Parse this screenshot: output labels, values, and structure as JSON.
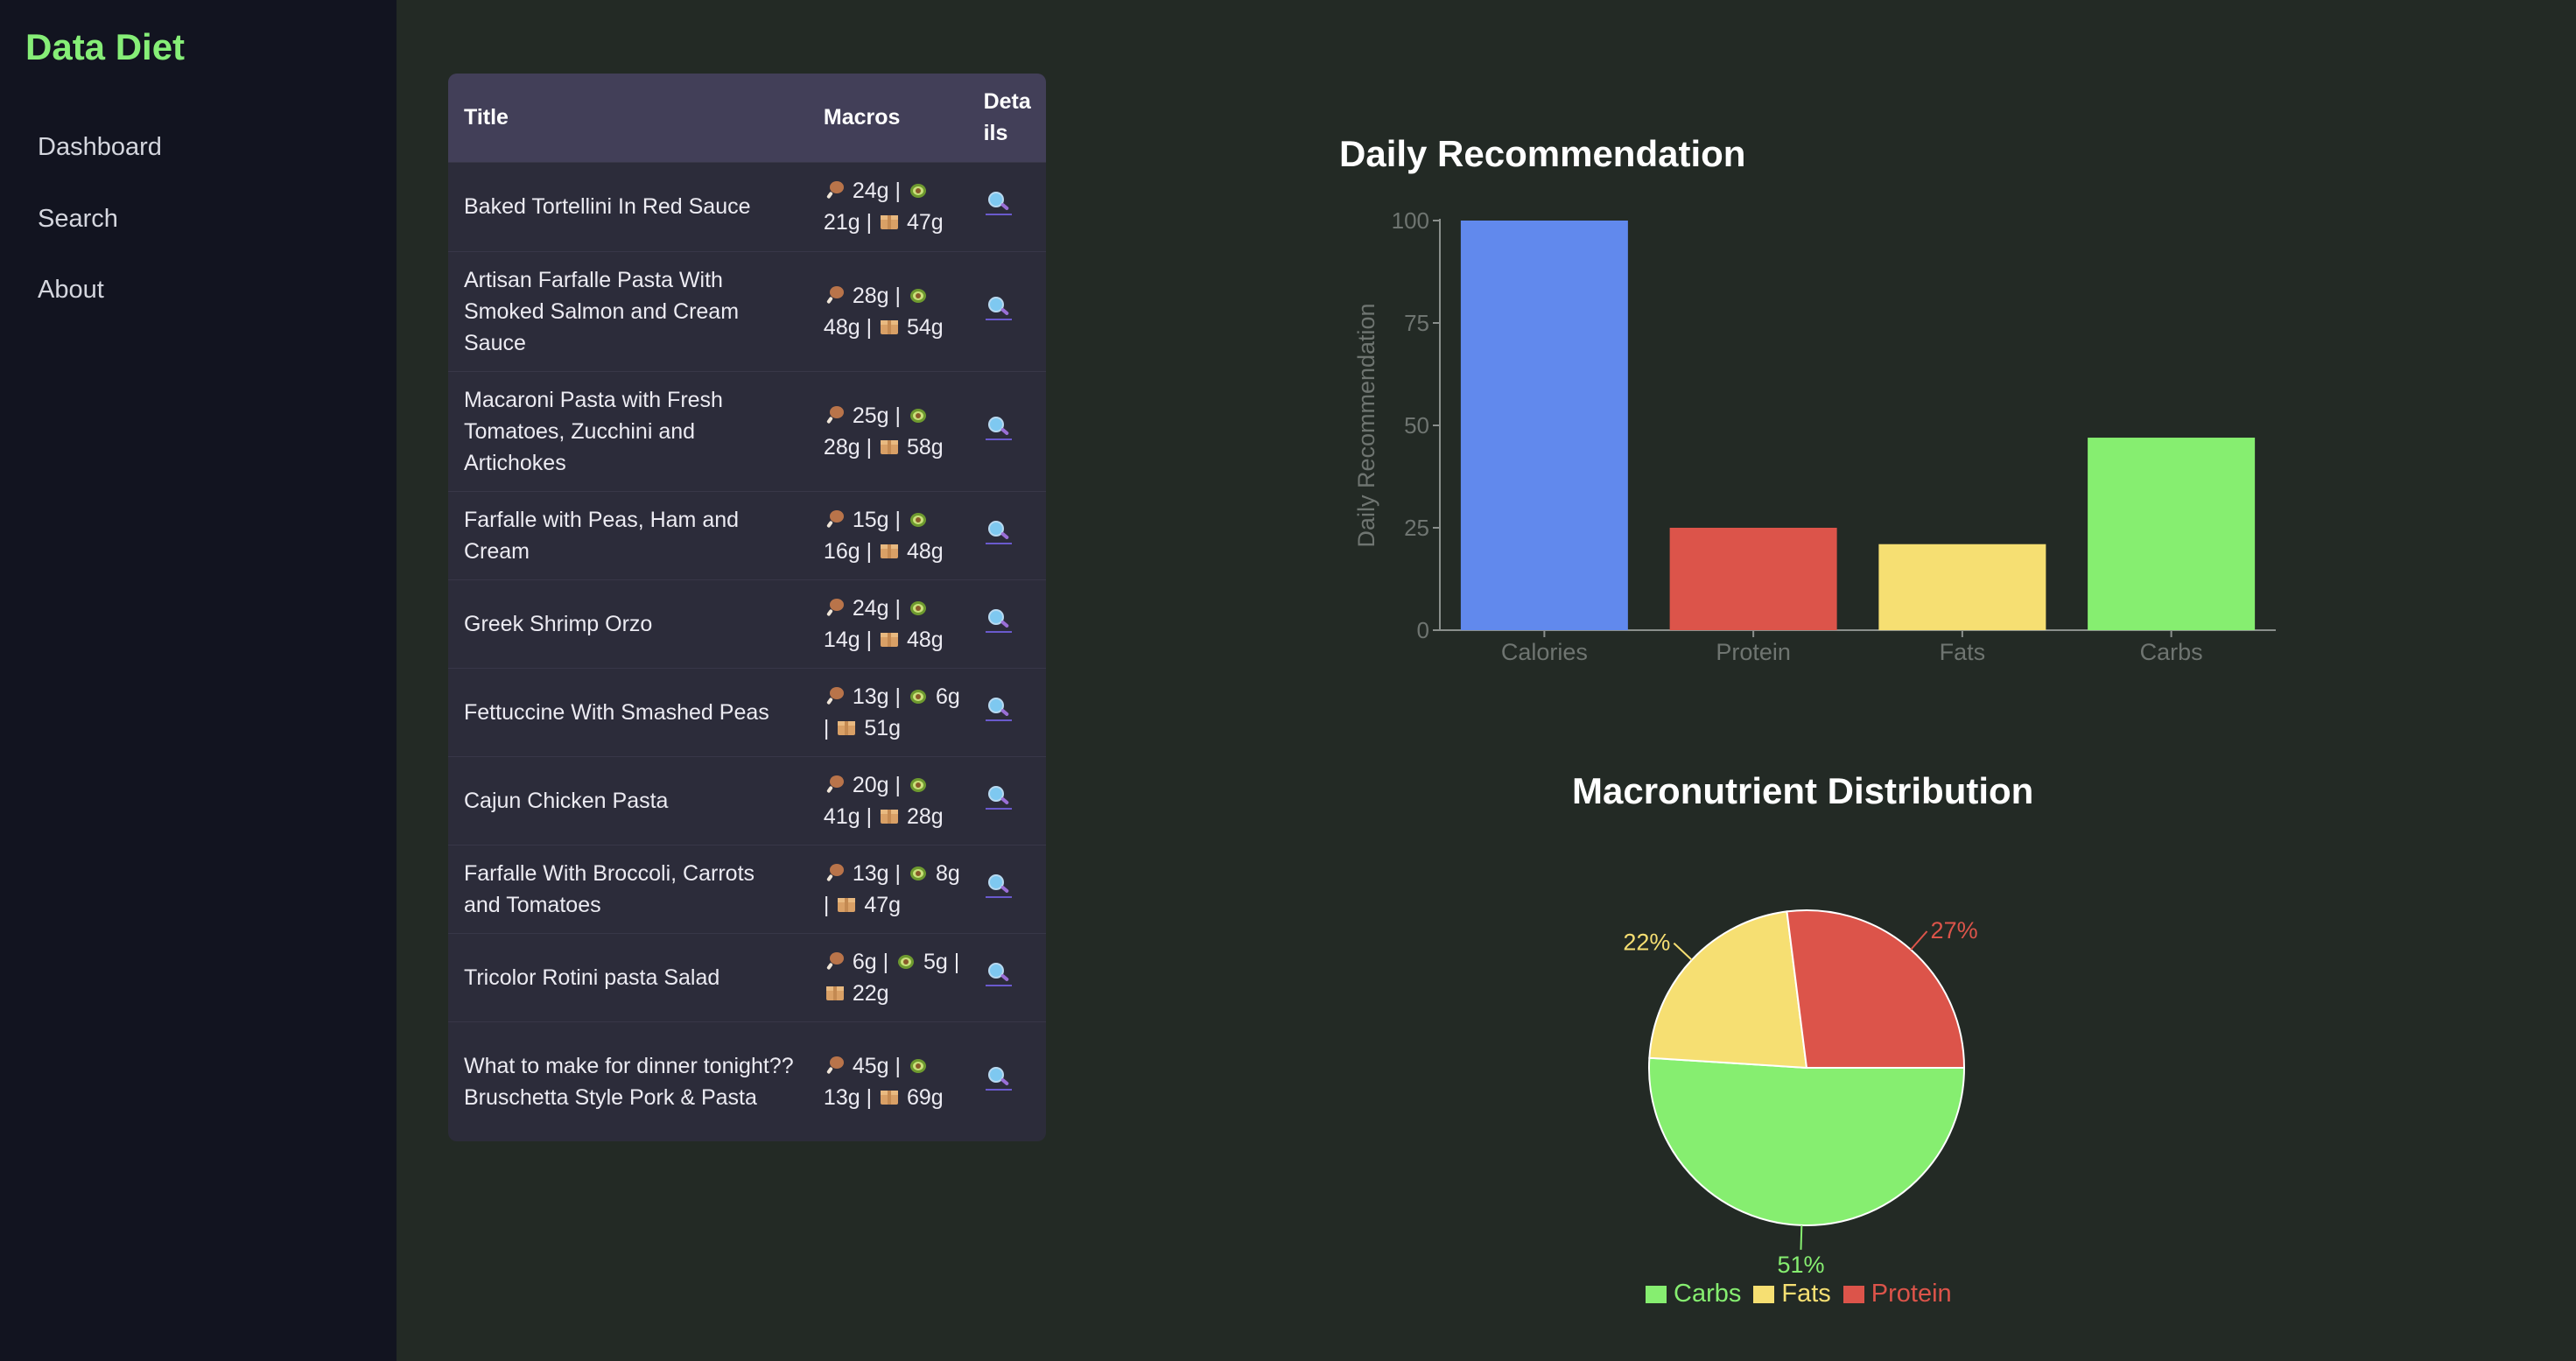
{
  "app": {
    "brand": "Data Diet"
  },
  "sidebar": {
    "items": [
      {
        "label": "Dashboard"
      },
      {
        "label": "Search"
      },
      {
        "label": "About"
      }
    ]
  },
  "table": {
    "headers": {
      "title": "Title",
      "macros": "Macros",
      "details": "Deta ils"
    },
    "rows": [
      {
        "title": "Baked Tortellini In Red Sauce",
        "protein": "24g",
        "fat": "21g",
        "carbs": "47g"
      },
      {
        "title": "Artisan Farfalle Pasta With Smoked Salmon and Cream Sauce",
        "protein": "28g",
        "fat": "48g",
        "carbs": "54g"
      },
      {
        "title": "Macaroni Pasta with Fresh Tomatoes, Zucchini and Artichokes",
        "protein": "25g",
        "fat": "28g",
        "carbs": "58g"
      },
      {
        "title": "Farfalle with Peas, Ham and Cream",
        "protein": "15g",
        "fat": "16g",
        "carbs": "48g"
      },
      {
        "title": "Greek Shrimp Orzo",
        "protein": "24g",
        "fat": "14g",
        "carbs": "48g"
      },
      {
        "title": "Fettuccine With Smashed Peas",
        "protein": "13g",
        "fat": "6g",
        "carbs": "51g"
      },
      {
        "title": "Cajun Chicken Pasta",
        "protein": "20g",
        "fat": "41g",
        "carbs": "28g"
      },
      {
        "title": "Farfalle With Broccoli, Carrots and Tomatoes",
        "protein": "13g",
        "fat": "8g",
        "carbs": "47g"
      },
      {
        "title": "Tricolor Rotini pasta Salad",
        "protein": "6g",
        "fat": "5g",
        "carbs": "22g"
      },
      {
        "title": "What to make for dinner tonight?? Bruschetta Style Pork & Pasta",
        "protein": "45g",
        "fat": "13g",
        "carbs": "69g"
      }
    ]
  },
  "colors": {
    "calories": "#6189ed",
    "protein": "#dc544a",
    "fats": "#f6df72",
    "carbs": "#86ee70"
  },
  "chart_data": [
    {
      "type": "bar",
      "title": "Daily Recommendation",
      "categories": [
        "Calories",
        "Protein",
        "Fats",
        "Carbs"
      ],
      "values": [
        100,
        25,
        21,
        47
      ],
      "ylabel": "Daily Recommendation",
      "ylim": [
        0,
        100
      ],
      "yticks": [
        0,
        25,
        50,
        75,
        100
      ],
      "grid": false
    },
    {
      "type": "pie",
      "title": "Macronutrient Distribution",
      "labels": [
        "Carbs",
        "Fats",
        "Protein"
      ],
      "values": [
        51,
        22,
        27
      ],
      "value_labels": [
        "51%",
        "22%",
        "27%"
      ],
      "legend": "bottom"
    }
  ]
}
